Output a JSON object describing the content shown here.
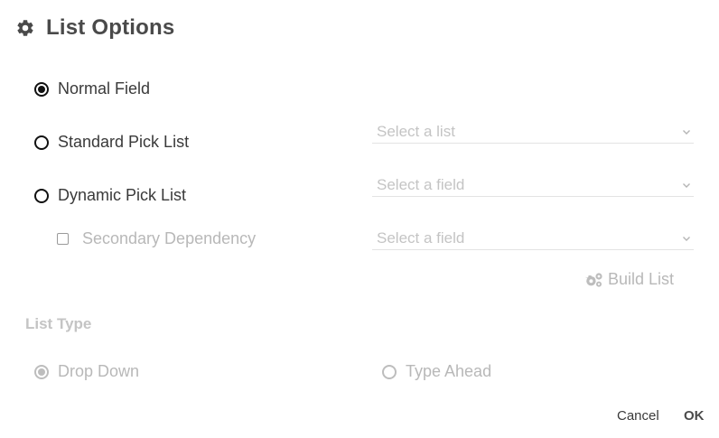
{
  "dialog": {
    "title": "List Options",
    "title_icon": "gear-icon"
  },
  "field_source": {
    "normal_field": {
      "label": "Normal Field",
      "selected": true
    },
    "standard_pick_list": {
      "label": "Standard Pick List",
      "selected": false,
      "select_placeholder": "Select a list"
    },
    "dynamic_pick_list": {
      "label": "Dynamic Pick List",
      "selected": false,
      "select_placeholder": "Select a field"
    },
    "secondary_dependency": {
      "label": "Secondary Dependency",
      "checked": false,
      "select_placeholder": "Select a field"
    },
    "build_list": {
      "label": "Build List",
      "icon": "gears-icon"
    }
  },
  "list_type": {
    "title": "List Type",
    "options": [
      {
        "label": "Drop Down",
        "selected": true
      },
      {
        "label": "Type Ahead",
        "selected": false
      }
    ]
  },
  "footer": {
    "cancel_label": "Cancel",
    "ok_label": "OK"
  },
  "colors": {
    "text": "#3a3a3a",
    "disabled": "#b8b8b8",
    "radio": "#111111",
    "underline": "#e3e3e3"
  }
}
